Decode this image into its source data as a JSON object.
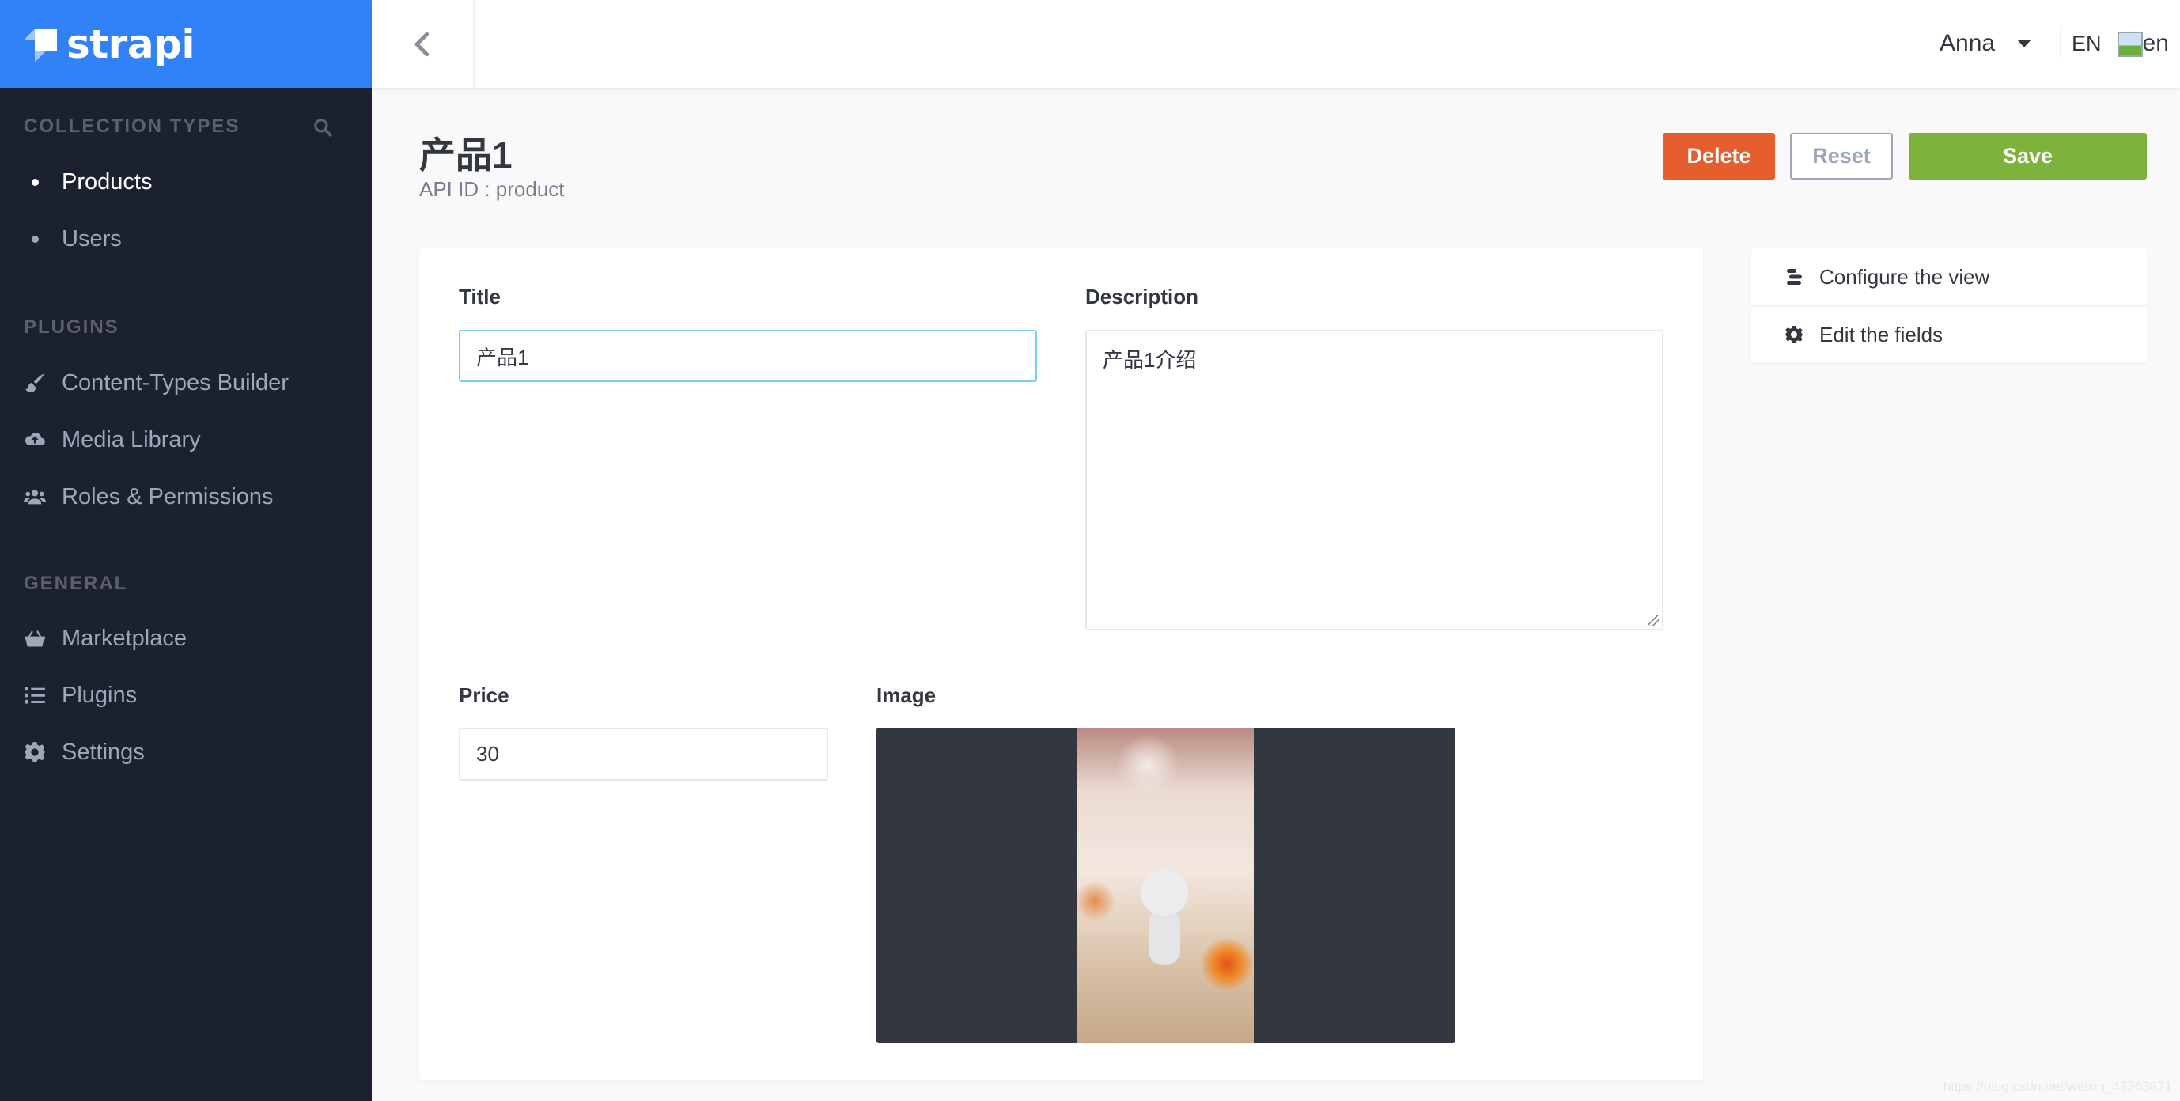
{
  "brand": {
    "name": "strapi",
    "color": "#3182f6"
  },
  "sidebar": {
    "collection_types": {
      "title": "Collection Types",
      "search_icon": "search-icon",
      "items": [
        {
          "label": "Products",
          "active": true
        },
        {
          "label": "Users",
          "active": false
        }
      ]
    },
    "plugins": {
      "title": "Plugins",
      "items": [
        {
          "label": "Content-Types Builder",
          "icon": "paint-brush-icon"
        },
        {
          "label": "Media Library",
          "icon": "cloud-upload-icon"
        },
        {
          "label": "Roles & Permissions",
          "icon": "users-icon"
        }
      ]
    },
    "general": {
      "title": "General",
      "items": [
        {
          "label": "Marketplace",
          "icon": "shopping-basket-icon"
        },
        {
          "label": "Plugins",
          "icon": "list-icon"
        },
        {
          "label": "Settings",
          "icon": "gear-icon"
        }
      ]
    }
  },
  "header": {
    "back_icon": "chevron-left-icon",
    "user_name": "Anna",
    "language": "EN",
    "flag_alt": "en"
  },
  "page": {
    "title": "产品1",
    "subtitle": "API ID : product",
    "buttons": {
      "delete": "Delete",
      "reset": "Reset",
      "save": "Save"
    },
    "colors": {
      "delete": "#e65e2e",
      "save": "#7db33c",
      "focus_border": "#78caff"
    }
  },
  "form": {
    "title": {
      "label": "Title",
      "value": "产品1"
    },
    "description": {
      "label": "Description",
      "value": "产品1介绍"
    },
    "price": {
      "label": "Price",
      "value": "30"
    },
    "image": {
      "label": "Image"
    }
  },
  "side_panel": {
    "links": [
      {
        "label": "Configure the view",
        "icon": "layout-icon"
      },
      {
        "label": "Edit the fields",
        "icon": "gear-icon"
      }
    ]
  },
  "watermark": "https://blog.csdn.net/weixin_43363871"
}
